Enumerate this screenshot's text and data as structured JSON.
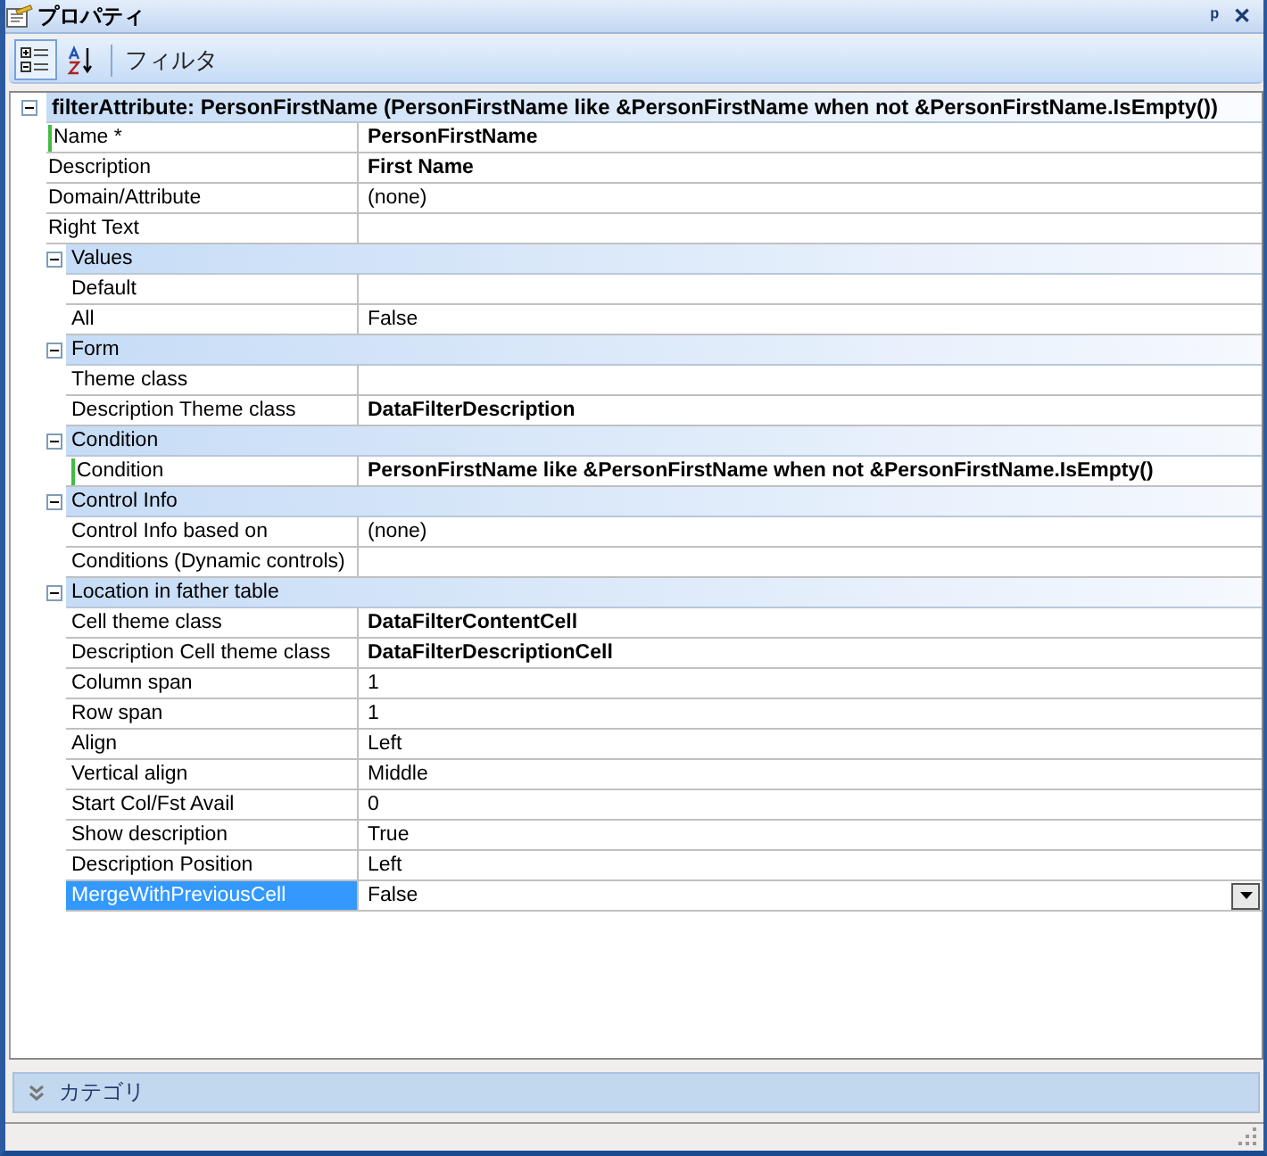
{
  "window": {
    "title": "プロパティ",
    "buttons": [
      "ᵖ",
      "✕"
    ]
  },
  "toolbar": {
    "buttons": [
      {
        "kind": "categorized",
        "selected": true
      },
      {
        "kind": "alphabetical",
        "selected": false
      }
    ],
    "filter_label": "フィルタ"
  },
  "grid": {
    "label": "filterAttribute: PersonFirstName (PersonFirstName like &PersonFirstName when not &PersonFirstName.IsEmpty())",
    "expanded": true,
    "properties": [
      {
        "name": "Name *",
        "value": "PersonFirstName",
        "bold": true,
        "modified": true,
        "selected": false
      },
      {
        "name": "Description",
        "value": "First Name",
        "bold": true,
        "modified": false,
        "selected": false
      },
      {
        "name": "Domain/Attribute",
        "value": "(none)",
        "bold": false,
        "modified": false,
        "selected": false
      },
      {
        "name": "Right Text",
        "bold": false,
        "modified": false,
        "selected": false
      }
    ],
    "categories": [
      {
        "label": "Values",
        "expanded": true,
        "properties": [
          {
            "name": "Default",
            "bold": false,
            "modified": false,
            "selected": false
          },
          {
            "name": "All",
            "value": "False",
            "bold": false,
            "modified": false,
            "selected": false
          }
        ]
      },
      {
        "label": "Form",
        "expanded": true,
        "properties": [
          {
            "name": "Theme class",
            "bold": false,
            "modified": false,
            "selected": false
          },
          {
            "name": "Description Theme class",
            "value": "DataFilterDescription",
            "bold": true,
            "modified": false,
            "selected": false
          }
        ]
      },
      {
        "label": "Condition",
        "expanded": true,
        "properties": [
          {
            "name": "Condition",
            "value": "PersonFirstName like &PersonFirstName when not &PersonFirstName.IsEmpty()",
            "bold": true,
            "modified": true,
            "selected": false
          }
        ]
      },
      {
        "label": "Control Info",
        "expanded": true,
        "properties": [
          {
            "name": "Control Info based on",
            "value": "(none)",
            "bold": false,
            "modified": false,
            "selected": false
          },
          {
            "name": "Conditions (Dynamic controls)",
            "bold": false,
            "modified": false,
            "selected": false
          }
        ]
      },
      {
        "label": "Location in father table",
        "expanded": true,
        "properties": [
          {
            "name": "Cell theme class",
            "value": "DataFilterContentCell",
            "bold": true,
            "modified": false,
            "selected": false
          },
          {
            "name": "Description Cell theme class",
            "value": "DataFilterDescriptionCell",
            "bold": true,
            "modified": false,
            "selected": false
          },
          {
            "name": "Column span",
            "value": "1",
            "bold": false,
            "modified": false,
            "selected": false
          },
          {
            "name": "Row span",
            "value": "1",
            "bold": false,
            "modified": false,
            "selected": false
          },
          {
            "name": "Align",
            "value": "Left",
            "bold": false,
            "modified": false,
            "selected": false
          },
          {
            "name": "Vertical align",
            "value": "Middle",
            "bold": false,
            "modified": false,
            "selected": false
          },
          {
            "name": "Start Col/Fst Avail",
            "value": "0",
            "bold": false,
            "modified": false,
            "selected": false
          },
          {
            "name": "Show description",
            "value": "True",
            "bold": false,
            "modified": false,
            "selected": false
          },
          {
            "name": "Description Position",
            "value": "Left",
            "bold": false,
            "modified": false,
            "selected": false
          },
          {
            "name": "MergeWithPreviousCell",
            "value": "False",
            "bold": false,
            "modified": false,
            "selected": true
          }
        ]
      }
    ]
  },
  "category_bar": {
    "label": "カテゴリ",
    "expanded": false
  }
}
